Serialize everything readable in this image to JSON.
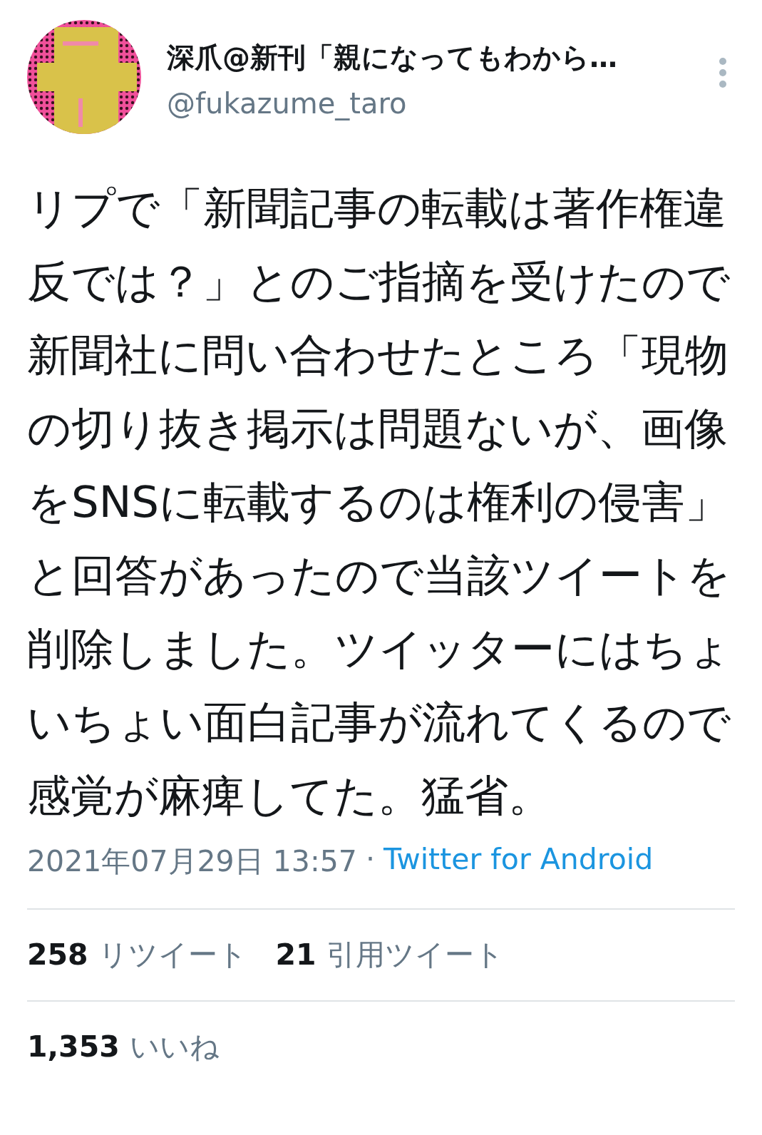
{
  "author": {
    "name": "深爪@新刊「親になってもわから…",
    "handle": "@fukazume_taro"
  },
  "body": "リプで「新聞記事の転載は著作権違反では？」とのご指摘を受けたので新聞社に問い合わせたところ「現物の切り抜き掲示は問題ないが、画像をSNSに転載するのは権利の侵害」と回答があったので当該ツイートを削除しました。ツイッターにはちょいちょい面白記事が流れてくるので感覚が麻痺してた。猛省。",
  "meta": {
    "timestamp": "2021年07月29日 13:57",
    "separator": "·",
    "source": "Twitter for Android"
  },
  "stats": [
    {
      "count": "258",
      "label": "リツイート"
    },
    {
      "count": "21",
      "label": "引用ツイート"
    }
  ],
  "likes": {
    "count": "1,353",
    "label": "いいね"
  }
}
